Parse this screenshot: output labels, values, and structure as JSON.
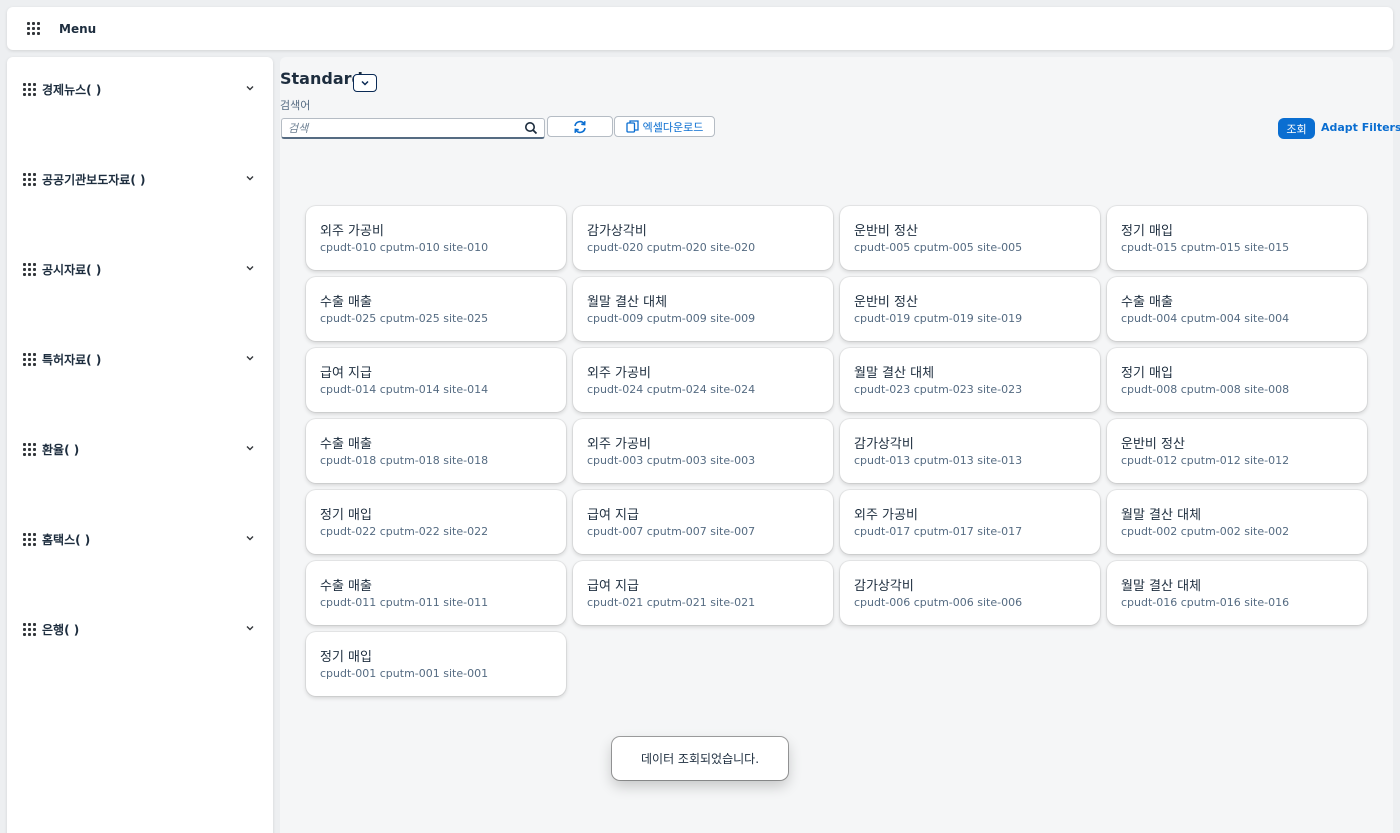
{
  "topbar": {
    "menu_label": "Menu"
  },
  "sidebar": {
    "items": [
      {
        "label": "경제뉴스( )"
      },
      {
        "label": "공공기관보도자료( )"
      },
      {
        "label": "공시자료( )"
      },
      {
        "label": "특허자료( )"
      },
      {
        "label": "환율( )"
      },
      {
        "label": "홈택스( )"
      },
      {
        "label": "은행( )"
      }
    ]
  },
  "filterbar": {
    "variant_title": "Standard",
    "search_label": "검색어",
    "search_placeholder": "검색",
    "search_value": "",
    "excel_label": "엑셀다운로드",
    "go_label": "조회",
    "adapt_label": "Adapt Filters"
  },
  "tiles": [
    {
      "title": "외주 가공비",
      "subtitle": "cpudt-010 cputm-010 site-010"
    },
    {
      "title": "감가상각비",
      "subtitle": "cpudt-020 cputm-020 site-020"
    },
    {
      "title": "운반비 정산",
      "subtitle": "cpudt-005 cputm-005 site-005"
    },
    {
      "title": "정기 매입",
      "subtitle": "cpudt-015 cputm-015 site-015"
    },
    {
      "title": "수출 매출",
      "subtitle": "cpudt-025 cputm-025 site-025"
    },
    {
      "title": "월말 결산 대체",
      "subtitle": "cpudt-009 cputm-009 site-009"
    },
    {
      "title": "운반비 정산",
      "subtitle": "cpudt-019 cputm-019 site-019"
    },
    {
      "title": "수출 매출",
      "subtitle": "cpudt-004 cputm-004 site-004"
    },
    {
      "title": "급여 지급",
      "subtitle": "cpudt-014 cputm-014 site-014"
    },
    {
      "title": "외주 가공비",
      "subtitle": "cpudt-024 cputm-024 site-024"
    },
    {
      "title": "월말 결산 대체",
      "subtitle": "cpudt-023 cputm-023 site-023"
    },
    {
      "title": "정기 매입",
      "subtitle": "cpudt-008 cputm-008 site-008"
    },
    {
      "title": "수출 매출",
      "subtitle": "cpudt-018 cputm-018 site-018"
    },
    {
      "title": "외주 가공비",
      "subtitle": "cpudt-003 cputm-003 site-003"
    },
    {
      "title": "감가상각비",
      "subtitle": "cpudt-013 cputm-013 site-013"
    },
    {
      "title": "운반비 정산",
      "subtitle": "cpudt-012 cputm-012 site-012"
    },
    {
      "title": "정기 매입",
      "subtitle": "cpudt-022 cputm-022 site-022"
    },
    {
      "title": "급여 지급",
      "subtitle": "cpudt-007 cputm-007 site-007"
    },
    {
      "title": "외주 가공비",
      "subtitle": "cpudt-017 cputm-017 site-017"
    },
    {
      "title": "월말 결산 대체",
      "subtitle": "cpudt-002 cputm-002 site-002"
    },
    {
      "title": "수출 매출",
      "subtitle": "cpudt-011 cputm-011 site-011"
    },
    {
      "title": "급여 지급",
      "subtitle": "cpudt-021 cputm-021 site-021"
    },
    {
      "title": "감가상각비",
      "subtitle": "cpudt-006 cputm-006 site-006"
    },
    {
      "title": "월말 결산 대체",
      "subtitle": "cpudt-016 cputm-016 site-016"
    },
    {
      "title": "정기 매입",
      "subtitle": "cpudt-001 cputm-001 site-001"
    }
  ],
  "toast": {
    "message": "데이터 조회되었습니다."
  },
  "colors": {
    "accent": "#0a6ed1",
    "text": "#1d2d3e",
    "muted": "#556b82",
    "page_bg": "#edeff1"
  },
  "icons": [
    "menu-grid-icon",
    "chevron-down-icon",
    "search-icon",
    "refresh-icon",
    "copy-icon"
  ]
}
